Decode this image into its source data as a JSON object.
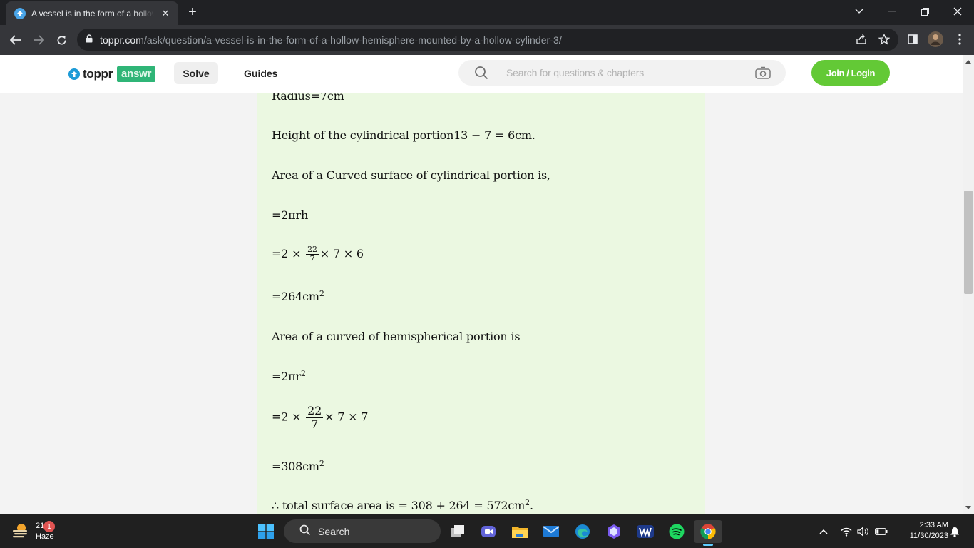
{
  "browser": {
    "tab_title": "A vessel is in the form of a hollow hemisphere mounted by a hollow cylinder",
    "tab_close": "✕",
    "new_tab": "+",
    "url_host": "toppr.com",
    "url_path": "/ask/question/a-vessel-is-in-the-form-of-a-hollow-hemisphere-mounted-by-a-hollow-cylinder-3/"
  },
  "site": {
    "logo_word": "toppr",
    "logo_badge": "answr",
    "nav_solve": "Solve",
    "nav_guides": "Guides",
    "search_placeholder": "Search for questions & chapters",
    "join_label": "Join / Login"
  },
  "solution": {
    "radius_line": "Radius=7cm",
    "height_line": "Height of the cylindrical portion13 − 7 = 6cm.",
    "cyl_area_heading": "Area of a Curved surface of cylindrical portion is,",
    "cyl_formula": "=2πrh",
    "cyl_sub_prefix": "=2 ×",
    "cyl_sub_num": "22",
    "cyl_sub_den": "7",
    "cyl_sub_suffix": "× 7 × 6",
    "cyl_result": "=264cm",
    "cyl_result_exp": "2",
    "hemi_heading": "Area of a curved of hemispherical portion is",
    "hemi_formula": "=2πr",
    "hemi_formula_exp": "2",
    "hemi_sub_prefix": "=2 ×",
    "hemi_sub_num": "22",
    "hemi_sub_den": "7",
    "hemi_sub_suffix": "× 7 × 7",
    "hemi_result": "=308cm",
    "hemi_result_exp": "2",
    "total_line": "∴ total surface area is = 308 + 264 = 572cm",
    "total_exp": "2",
    "total_end": "."
  },
  "taskbar": {
    "temperature": "21°C",
    "condition": "Haze",
    "notif_count": "1",
    "search_label": "Search",
    "time": "2:33 AM",
    "date": "11/30/2023"
  },
  "colors": {
    "answer_bg": "#ebf8e1",
    "join_green": "#63c936",
    "answr_green": "#2fb577",
    "chrome_dark": "#202124"
  }
}
